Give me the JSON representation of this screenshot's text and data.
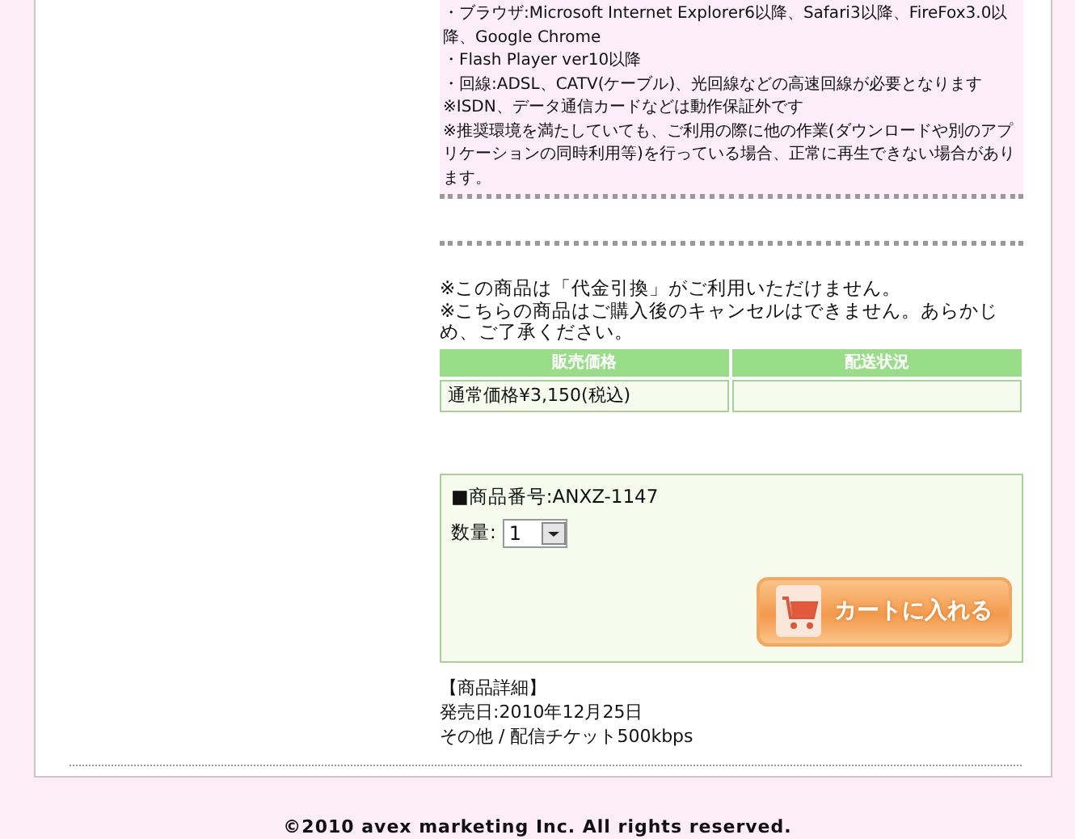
{
  "requirements": [
    "・ブラウザ:Microsoft Internet Explorer6以降、Safari3以降、FireFox3.0以降、Google Chrome",
    "・Flash Player ver10以降",
    "・回線:ADSL、CATV(ケーブル)、光回線などの高速回線が必要となります",
    "※ISDN、データ通信カードなどは動作保証外です",
    "※推奨環境を満たしていても、ご利用の際に他の作業(ダウンロードや別のアプリケーションの同時利用等)を行っている場合、正常に再生できない場合があります。"
  ],
  "notices": [
    "※この商品は「代金引換」がご利用いただけません。",
    "※こちらの商品はご購入後のキャンセルはできません。あらかじめ、ご了承ください。"
  ],
  "table": {
    "columns": [
      "販売価格",
      "配送状況"
    ],
    "rows": [
      {
        "price": "通常価格¥3,150(税込)"
      }
    ]
  },
  "product": {
    "code_label": "■商品番号:ANXZ-1147",
    "quantity_label": "数量:",
    "quantity_value": "1",
    "cart_button": "カートに入れる"
  },
  "details": [
    "【商品詳細】",
    "発売日:2010年12月25日",
    "その他 / 配信チケット500kbps"
  ],
  "footer": "©2010 avex marketing Inc. All rights reserved."
}
